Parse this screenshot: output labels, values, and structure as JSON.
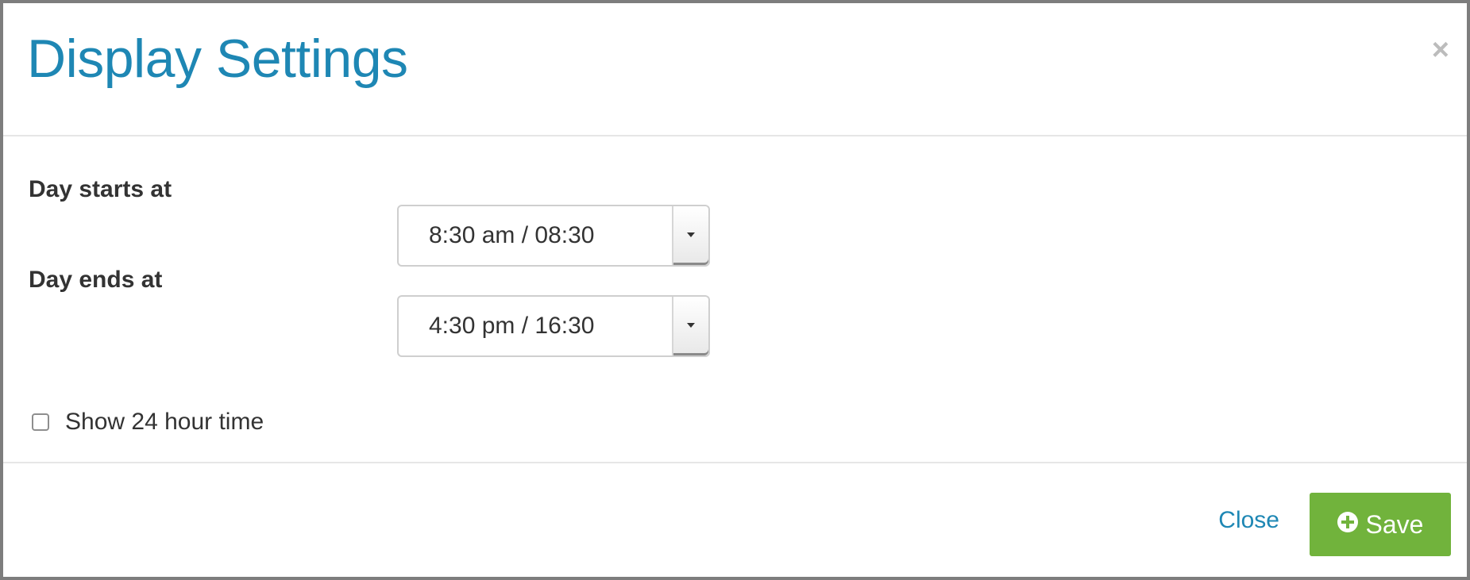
{
  "dialog": {
    "title": "Display Settings",
    "close_icon": "close-icon"
  },
  "form": {
    "day_start": {
      "label": "Day starts at",
      "value": "8:30 am / 08:30"
    },
    "day_end": {
      "label": "Day ends at",
      "value": "4:30 pm / 16:30"
    },
    "show_24h": {
      "label": "Show 24 hour time",
      "checked": false
    }
  },
  "footer": {
    "close_label": "Close",
    "save_label": "Save",
    "save_icon": "plus-circle-icon"
  },
  "colors": {
    "accent": "#1e87b4",
    "save_button": "#71b33c",
    "border": "#7d7d7d"
  }
}
